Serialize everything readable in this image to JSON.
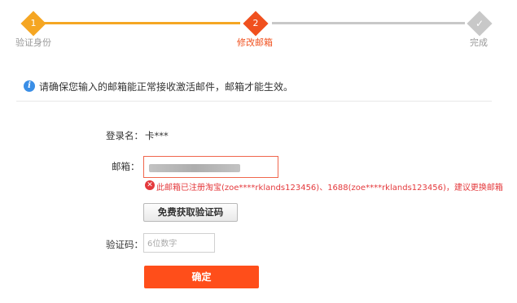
{
  "stepper": {
    "steps": [
      {
        "number": "1",
        "label": "验证身份",
        "state": "done"
      },
      {
        "number": "2",
        "label": "修改邮箱",
        "state": "active"
      },
      {
        "number": "",
        "label": "完成",
        "state": "pending"
      }
    ],
    "colors": {
      "done": "#f5a623",
      "active": "#f0501e",
      "pending": "#c8c8c8",
      "done_label": "#999999"
    }
  },
  "notice": {
    "icon": "info-icon",
    "text": "请确保您输入的邮箱能正常接收激活邮件，邮箱才能生效。"
  },
  "form": {
    "login_label": "登录名：",
    "login_value": "卡***",
    "email_label": "邮箱：",
    "email_value_masked": true,
    "error_icon": "error-circle-icon",
    "error_text": "此邮箱已注册淘宝(zoe****rklands123456)、1688(zoe****rklands123456)，建议更换邮箱",
    "get_code_label": "免费获取验证码",
    "code_label": "验证码：",
    "code_placeholder": "6位数字",
    "submit_label": "确定"
  }
}
